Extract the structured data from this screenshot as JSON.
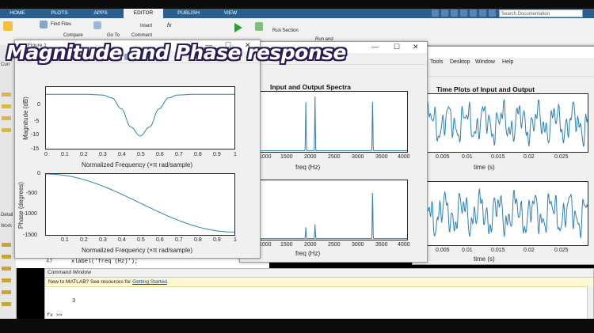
{
  "tabs": [
    "HOME",
    "PLOTS",
    "APPS",
    "EDITOR",
    "PUBLISH",
    "VIEW"
  ],
  "search": {
    "placeholder": "Search Documentation"
  },
  "ribbon": {
    "find_files": "Find Files",
    "compare": "Compare",
    "goto": "Go To",
    "insert": "Insert",
    "fx": "fx",
    "comment": "Comment",
    "run_section": "Run Section",
    "run_and": "Run and"
  },
  "left_panel": {
    "current": "Curr",
    "details": "Detail",
    "workspace": "Work"
  },
  "overlay_title": "Magnitude and Phase response",
  "figure1": {
    "title": "Figure 1",
    "mag_ylabel": "Magnitude (dB)",
    "phase_ylabel": "Phase (degrees)",
    "xlabel": "Normalized Frequency  (×π rad/sample)",
    "mag_yticks": [
      "0",
      "-5",
      "-10",
      "-15"
    ],
    "phase_yticks": [
      "0",
      "-500",
      "-1000",
      "-1500"
    ],
    "xticks": [
      "0",
      "0.1",
      "0.2",
      "0.3",
      "0.4",
      "0.5",
      "0.6",
      "0.7",
      "0.8",
      "0.9",
      "1"
    ]
  },
  "figure2": {
    "title": "Input and Output Spectra",
    "xlabel": "freq (Hz)",
    "xticks": [
      "1000",
      "1500",
      "2000",
      "2500",
      "3000",
      "3500",
      "4000"
    ]
  },
  "figure3": {
    "menu": [
      "Tools",
      "Desktop",
      "Window",
      "Help"
    ],
    "title": "Time Plots of Input and Output",
    "xlabel": "time (s)",
    "xticks": [
      "0.005",
      "0.01",
      "0.015",
      "0.02",
      "0.025"
    ]
  },
  "editor": {
    "line_number": "47",
    "code_line": "xlabel('freq (Hz)');"
  },
  "command_window": {
    "title": "Command Window",
    "notice_text": "New to MATLAB? See resources for ",
    "notice_link": "Getting Started",
    "notice_end": ".",
    "output": "3",
    "prompt": "fx >>"
  },
  "chart_data": [
    {
      "type": "line",
      "ylabel": "Magnitude (dB)",
      "xlabel": "Normalized Frequency  (×π rad/sample)",
      "xlim": [
        0,
        1
      ],
      "ylim": [
        -15,
        2
      ],
      "x": [
        0,
        0.1,
        0.2,
        0.3,
        0.35,
        0.4,
        0.45,
        0.5,
        0.55,
        0.6,
        0.65,
        0.7,
        0.8,
        0.9,
        1
      ],
      "y": [
        0,
        0,
        0,
        -0.2,
        -1,
        -4,
        -9,
        -11.5,
        -9,
        -4,
        -1,
        -0.2,
        0,
        0,
        0
      ]
    },
    {
      "type": "line",
      "ylabel": "Phase (degrees)",
      "xlabel": "Normalized Frequency  (×π rad/sample)",
      "xlim": [
        0,
        1
      ],
      "ylim": [
        -1500,
        0
      ],
      "x": [
        0,
        1
      ],
      "y": [
        0,
        -1430
      ]
    },
    {
      "type": "line",
      "title": "Input and Output Spectra",
      "xlabel": "freq (Hz)",
      "xlim": [
        800,
        4000
      ],
      "peaks_hz": [
        1800,
        2000,
        3250
      ],
      "input_peak_heights": [
        0.85,
        0.95,
        0.9
      ],
      "output_peak_heights": [
        0.2,
        0.25,
        0.85
      ]
    },
    {
      "type": "line",
      "title": "Time Plots of Input and Output",
      "xlabel": "time (s)",
      "xlim": [
        0,
        0.025
      ]
    }
  ]
}
